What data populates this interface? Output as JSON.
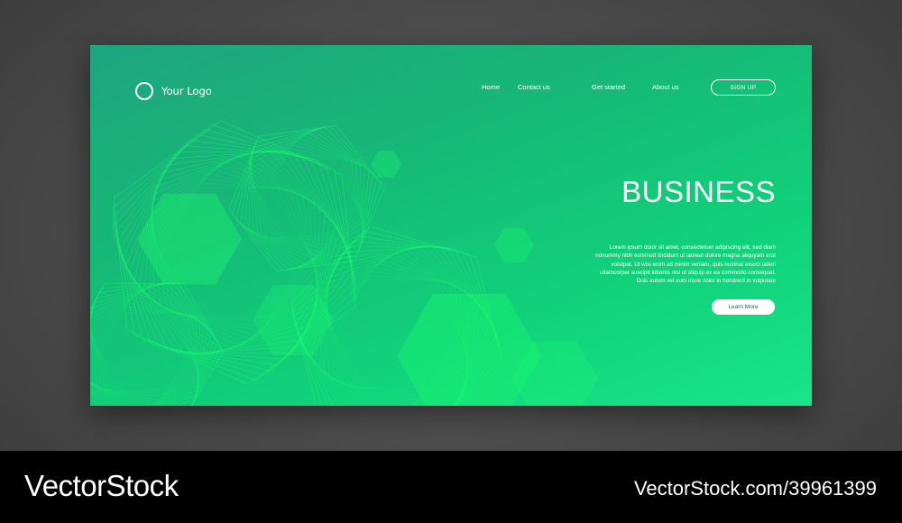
{
  "logo": {
    "text": "Your Logo",
    "icon": "circle-logo-icon"
  },
  "nav": {
    "items": [
      {
        "label": "Home"
      },
      {
        "label": "Contact us"
      },
      {
        "label": "Get started"
      },
      {
        "label": "About us"
      }
    ],
    "signup_label": "SIGN UP"
  },
  "hero": {
    "title": "BUSINESS",
    "body": "Lorem ipsum dolor sit amet, consectetuer adipiscing elit, sed diam nonummy nibh euismod tincidunt ut laoreet dolore magna aliquyam erat volutpat. Ut wisi enim ad minim veniam, quis nostrud exerci tation ullamcorper suscipit lobortis nisl ut aliquip ex ea commodo consequat. Duis autem vel eum iriure dolor in hendrerit in vulputate",
    "cta_label": "Learn More"
  },
  "footer": {
    "brand": "VectorStock",
    "credit": "VectorStock.com/39961399"
  },
  "colors": {
    "primary_green": "#10d27a",
    "dark_green": "#1fa57f",
    "accent_green": "#1cff6e"
  }
}
